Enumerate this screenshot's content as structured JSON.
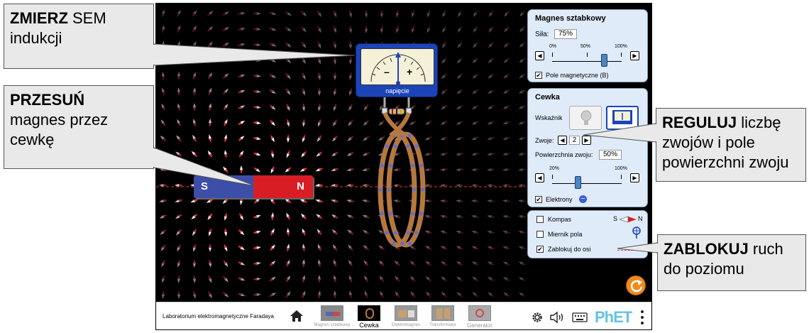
{
  "callouts": {
    "measure": {
      "bold": "ZMIERZ",
      "rest": " SEM",
      "line2": "indukcji"
    },
    "move": {
      "bold": "PRZESUŃ",
      "line2": "magnes przez",
      "line3": "cewkę"
    },
    "adjust": {
      "bold": "REGULUJ",
      "rest": " liczbę",
      "line2": "zwojów i pole",
      "line3": "powierzchni zwoju"
    },
    "lock": {
      "bold": "ZABLOKUJ",
      "rest": " ruch",
      "line2": "do poziomu"
    }
  },
  "magnet": {
    "south": "S",
    "north": "N"
  },
  "meter": {
    "minus": "–",
    "plus": "+",
    "label": "napięcie"
  },
  "bar_magnet_panel": {
    "title": "Magnes sztabkowy",
    "strength_label": "Siła:",
    "strength_value": "75%",
    "strength_fraction": 0.75,
    "ticks": [
      "0%",
      "50%",
      "100%"
    ],
    "field_checkbox": "Pole magnetyczne (B)",
    "field_checked": true
  },
  "coil_panel": {
    "title": "Cewka",
    "indicator_label": "Wskaźnik",
    "loops_label": "Zwoje:",
    "loops_value": "2",
    "area_label": "Powierzchnia zwoju:",
    "area_value": "50%",
    "area_fraction": 0.5,
    "ticks": [
      "20%",
      "100%"
    ],
    "electrons_label": "Elektrony",
    "electrons_checked": true
  },
  "tools_panel": {
    "compass_label": "Kompas",
    "compass_checked": false,
    "compass_s": "S",
    "compass_n": "N",
    "field_meter_label": "Miernik pola",
    "field_meter_checked": false,
    "lock_label": "Zablokuj do osi",
    "lock_checked": true
  },
  "navbar": {
    "sim_title": "Laboratorium elektromagnetyczne Faradaya",
    "screens": [
      "Magnes sztabkowy",
      "Cewka",
      "Elektromagnes",
      "Transformator",
      "Generator"
    ],
    "selected": "Cewka",
    "brand": "PhET"
  },
  "colors": {
    "panel_bg": "#e0ebfa",
    "magnet_south": "#3c4ea8",
    "magnet_north": "#d81e24",
    "coil_copper": "#b5793f",
    "meter_blue": "#1b44b8",
    "reset_orange": "#f08a1d"
  }
}
